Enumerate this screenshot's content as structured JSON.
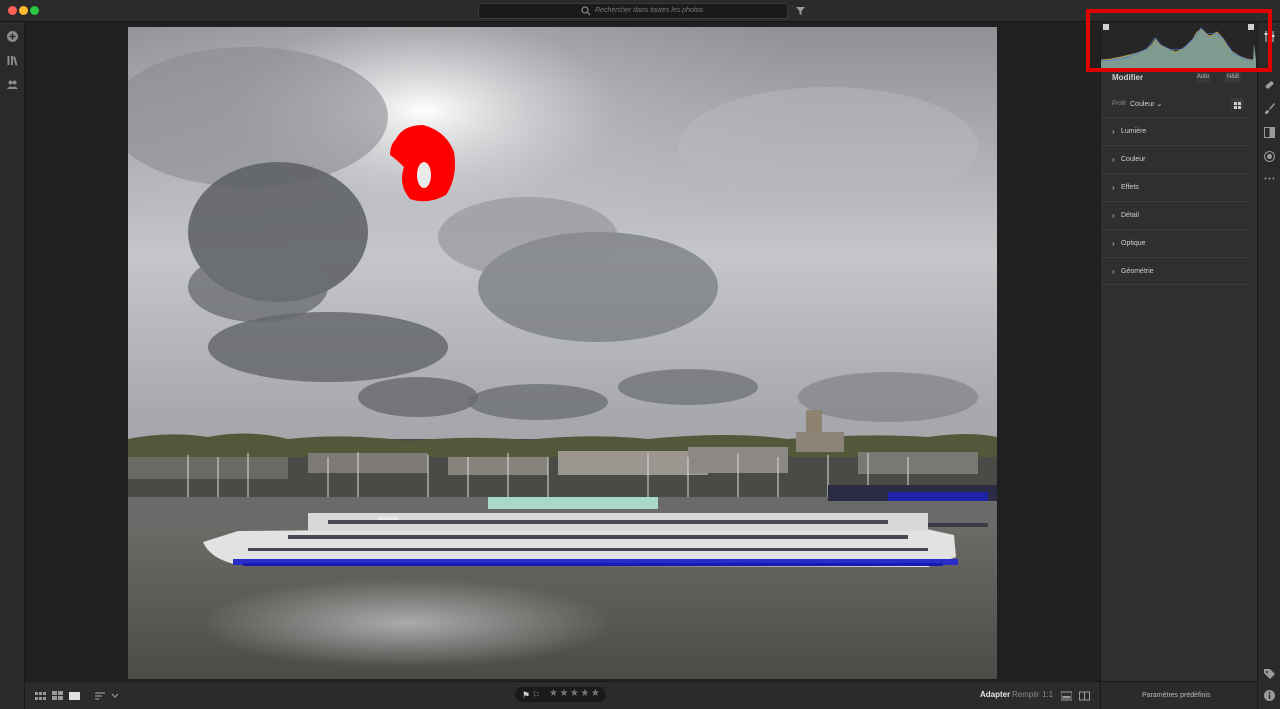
{
  "window": {
    "traffic_lights": [
      "#ff5f57",
      "#febc2e",
      "#28c840"
    ]
  },
  "search": {
    "placeholder": "Rechercher dans toutes les photos",
    "icon": "search-icon"
  },
  "left_rail": {
    "icons": [
      "add-photos-icon",
      "library-icon",
      "people-icon"
    ]
  },
  "photo": {
    "overlays": {
      "highlight_clipping_color": "#ff0000",
      "shadow_clipping_color": "#0000ff"
    }
  },
  "bottom_toolbar": {
    "view_icons": [
      "grid-small-icon",
      "grid-large-icon",
      "single-view-icon",
      "sort-icon"
    ],
    "rating_stars": "★★★★★",
    "zoom": {
      "fit": "Adapter",
      "fill": "Remplir",
      "ratio": "1:1"
    },
    "compare_icons": [
      "filmstrip-icon",
      "compare-icon"
    ]
  },
  "edit_panel": {
    "title": "Modifier",
    "auto_label": "Auto",
    "bw_label": "N&B",
    "profile_label": "Profil",
    "profile_value": "Couleur",
    "sections": [
      "Lumière",
      "Couleur",
      "Effets",
      "Détail",
      "Optique",
      "Géométrie"
    ],
    "presets_label": "Paramètres prédéfinis"
  },
  "right_rail": {
    "icons": [
      "edit-sliders-icon",
      "healing-brush-icon",
      "brush-icon",
      "linear-gradient-icon",
      "radial-gradient-icon",
      "more-icon",
      "tag-icon",
      "info-icon"
    ]
  },
  "annotation": {
    "color": "#e00000"
  }
}
